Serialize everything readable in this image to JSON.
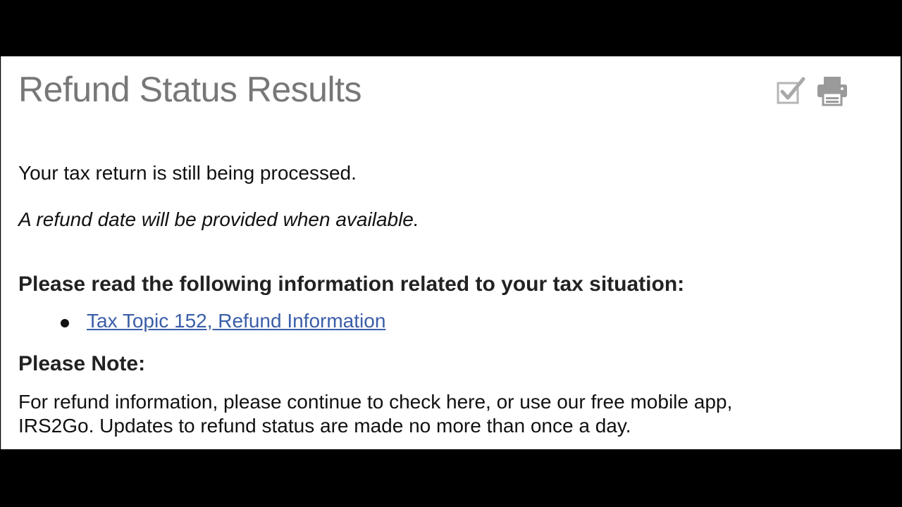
{
  "page": {
    "title": "Refund Status Results"
  },
  "toolbar": {
    "icons": [
      {
        "name": "checkmark-icon",
        "color": "#a9a9a9"
      },
      {
        "name": "printer-icon",
        "color": "#9a9a9a"
      }
    ]
  },
  "status": {
    "message": "Your tax return is still being processed.",
    "subtext": "A refund date will be provided when available."
  },
  "info": {
    "heading": "Please read the following information related to your tax situation:",
    "links": [
      {
        "label": "Tax Topic 152, Refund Information"
      }
    ]
  },
  "note": {
    "heading": "Please Note:",
    "body_line1": "For refund information, please continue to check here, or use our free mobile app,",
    "body_line2": "IRS2Go. Updates to refund status are made no more than once a day."
  },
  "colors": {
    "title": "#777777",
    "link": "#3a5ea8",
    "background": "#ffffff",
    "letterbox": "#000000"
  }
}
